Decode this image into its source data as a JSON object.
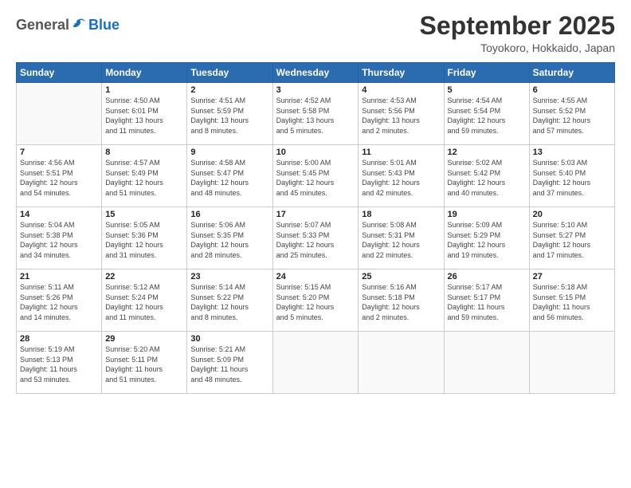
{
  "header": {
    "logo_general": "General",
    "logo_blue": "Blue",
    "month_title": "September 2025",
    "location": "Toyokoro, Hokkaido, Japan"
  },
  "days_of_week": [
    "Sunday",
    "Monday",
    "Tuesday",
    "Wednesday",
    "Thursday",
    "Friday",
    "Saturday"
  ],
  "weeks": [
    [
      {
        "day": "",
        "info": ""
      },
      {
        "day": "1",
        "info": "Sunrise: 4:50 AM\nSunset: 6:01 PM\nDaylight: 13 hours\nand 11 minutes."
      },
      {
        "day": "2",
        "info": "Sunrise: 4:51 AM\nSunset: 5:59 PM\nDaylight: 13 hours\nand 8 minutes."
      },
      {
        "day": "3",
        "info": "Sunrise: 4:52 AM\nSunset: 5:58 PM\nDaylight: 13 hours\nand 5 minutes."
      },
      {
        "day": "4",
        "info": "Sunrise: 4:53 AM\nSunset: 5:56 PM\nDaylight: 13 hours\nand 2 minutes."
      },
      {
        "day": "5",
        "info": "Sunrise: 4:54 AM\nSunset: 5:54 PM\nDaylight: 12 hours\nand 59 minutes."
      },
      {
        "day": "6",
        "info": "Sunrise: 4:55 AM\nSunset: 5:52 PM\nDaylight: 12 hours\nand 57 minutes."
      }
    ],
    [
      {
        "day": "7",
        "info": "Sunrise: 4:56 AM\nSunset: 5:51 PM\nDaylight: 12 hours\nand 54 minutes."
      },
      {
        "day": "8",
        "info": "Sunrise: 4:57 AM\nSunset: 5:49 PM\nDaylight: 12 hours\nand 51 minutes."
      },
      {
        "day": "9",
        "info": "Sunrise: 4:58 AM\nSunset: 5:47 PM\nDaylight: 12 hours\nand 48 minutes."
      },
      {
        "day": "10",
        "info": "Sunrise: 5:00 AM\nSunset: 5:45 PM\nDaylight: 12 hours\nand 45 minutes."
      },
      {
        "day": "11",
        "info": "Sunrise: 5:01 AM\nSunset: 5:43 PM\nDaylight: 12 hours\nand 42 minutes."
      },
      {
        "day": "12",
        "info": "Sunrise: 5:02 AM\nSunset: 5:42 PM\nDaylight: 12 hours\nand 40 minutes."
      },
      {
        "day": "13",
        "info": "Sunrise: 5:03 AM\nSunset: 5:40 PM\nDaylight: 12 hours\nand 37 minutes."
      }
    ],
    [
      {
        "day": "14",
        "info": "Sunrise: 5:04 AM\nSunset: 5:38 PM\nDaylight: 12 hours\nand 34 minutes."
      },
      {
        "day": "15",
        "info": "Sunrise: 5:05 AM\nSunset: 5:36 PM\nDaylight: 12 hours\nand 31 minutes."
      },
      {
        "day": "16",
        "info": "Sunrise: 5:06 AM\nSunset: 5:35 PM\nDaylight: 12 hours\nand 28 minutes."
      },
      {
        "day": "17",
        "info": "Sunrise: 5:07 AM\nSunset: 5:33 PM\nDaylight: 12 hours\nand 25 minutes."
      },
      {
        "day": "18",
        "info": "Sunrise: 5:08 AM\nSunset: 5:31 PM\nDaylight: 12 hours\nand 22 minutes."
      },
      {
        "day": "19",
        "info": "Sunrise: 5:09 AM\nSunset: 5:29 PM\nDaylight: 12 hours\nand 19 minutes."
      },
      {
        "day": "20",
        "info": "Sunrise: 5:10 AM\nSunset: 5:27 PM\nDaylight: 12 hours\nand 17 minutes."
      }
    ],
    [
      {
        "day": "21",
        "info": "Sunrise: 5:11 AM\nSunset: 5:26 PM\nDaylight: 12 hours\nand 14 minutes."
      },
      {
        "day": "22",
        "info": "Sunrise: 5:12 AM\nSunset: 5:24 PM\nDaylight: 12 hours\nand 11 minutes."
      },
      {
        "day": "23",
        "info": "Sunrise: 5:14 AM\nSunset: 5:22 PM\nDaylight: 12 hours\nand 8 minutes."
      },
      {
        "day": "24",
        "info": "Sunrise: 5:15 AM\nSunset: 5:20 PM\nDaylight: 12 hours\nand 5 minutes."
      },
      {
        "day": "25",
        "info": "Sunrise: 5:16 AM\nSunset: 5:18 PM\nDaylight: 12 hours\nand 2 minutes."
      },
      {
        "day": "26",
        "info": "Sunrise: 5:17 AM\nSunset: 5:17 PM\nDaylight: 11 hours\nand 59 minutes."
      },
      {
        "day": "27",
        "info": "Sunrise: 5:18 AM\nSunset: 5:15 PM\nDaylight: 11 hours\nand 56 minutes."
      }
    ],
    [
      {
        "day": "28",
        "info": "Sunrise: 5:19 AM\nSunset: 5:13 PM\nDaylight: 11 hours\nand 53 minutes."
      },
      {
        "day": "29",
        "info": "Sunrise: 5:20 AM\nSunset: 5:11 PM\nDaylight: 11 hours\nand 51 minutes."
      },
      {
        "day": "30",
        "info": "Sunrise: 5:21 AM\nSunset: 5:09 PM\nDaylight: 11 hours\nand 48 minutes."
      },
      {
        "day": "",
        "info": ""
      },
      {
        "day": "",
        "info": ""
      },
      {
        "day": "",
        "info": ""
      },
      {
        "day": "",
        "info": ""
      }
    ]
  ]
}
